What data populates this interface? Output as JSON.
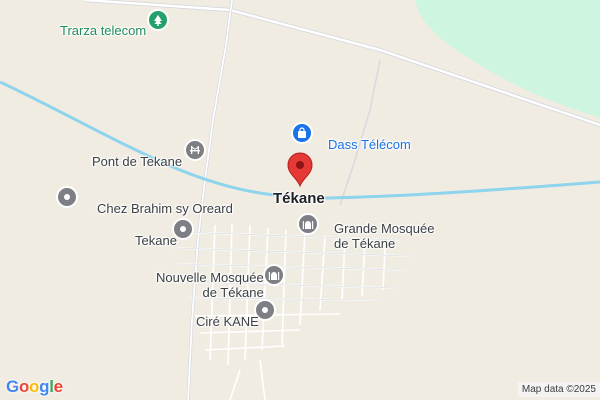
{
  "map": {
    "colors": {
      "land": "#f1ece2",
      "park": "#cdf5df",
      "water_line": "#8dd4ec",
      "road": "#ffffff",
      "road_edge": "#cfd4dc",
      "marker": "#e53935"
    },
    "main_label": "Tékane",
    "places": [
      {
        "id": "trarza-telecom",
        "label": "Trarza telecom",
        "icon": "tree-icon",
        "style": "green"
      },
      {
        "id": "dass-telecom",
        "label": "Dass Télécom",
        "icon": "shopping-bag-icon",
        "style": "blue"
      },
      {
        "id": "pont-de-tekane",
        "label": "Pont de Tekane",
        "icon": "bridge-icon",
        "style": "gray"
      },
      {
        "id": "chez-brahim",
        "label": "Chez Brahim sy Oreard",
        "icon": "place-icon",
        "style": "gray"
      },
      {
        "id": "tekane-place",
        "label": "Tekane",
        "icon": "place-icon",
        "style": "gray"
      },
      {
        "id": "grande-mosquee",
        "label": "Grande Mosquée",
        "label2": "de Tékane",
        "icon": "mosque-icon",
        "style": "gray"
      },
      {
        "id": "nouvelle-mosquee",
        "label": "Nouvelle Mosquée",
        "label2": "de Tékane",
        "icon": "mosque-icon",
        "style": "gray"
      },
      {
        "id": "cire-kane",
        "label": "Ciré KANE",
        "icon": "place-icon",
        "style": "gray"
      }
    ],
    "google_logo": [
      "G",
      "o",
      "o",
      "g",
      "l",
      "e"
    ],
    "google_colors": [
      "#4285f4",
      "#ea4335",
      "#fbbc05",
      "#4285f4",
      "#34a853",
      "#ea4335"
    ],
    "attribution": "Map data ©2025"
  }
}
